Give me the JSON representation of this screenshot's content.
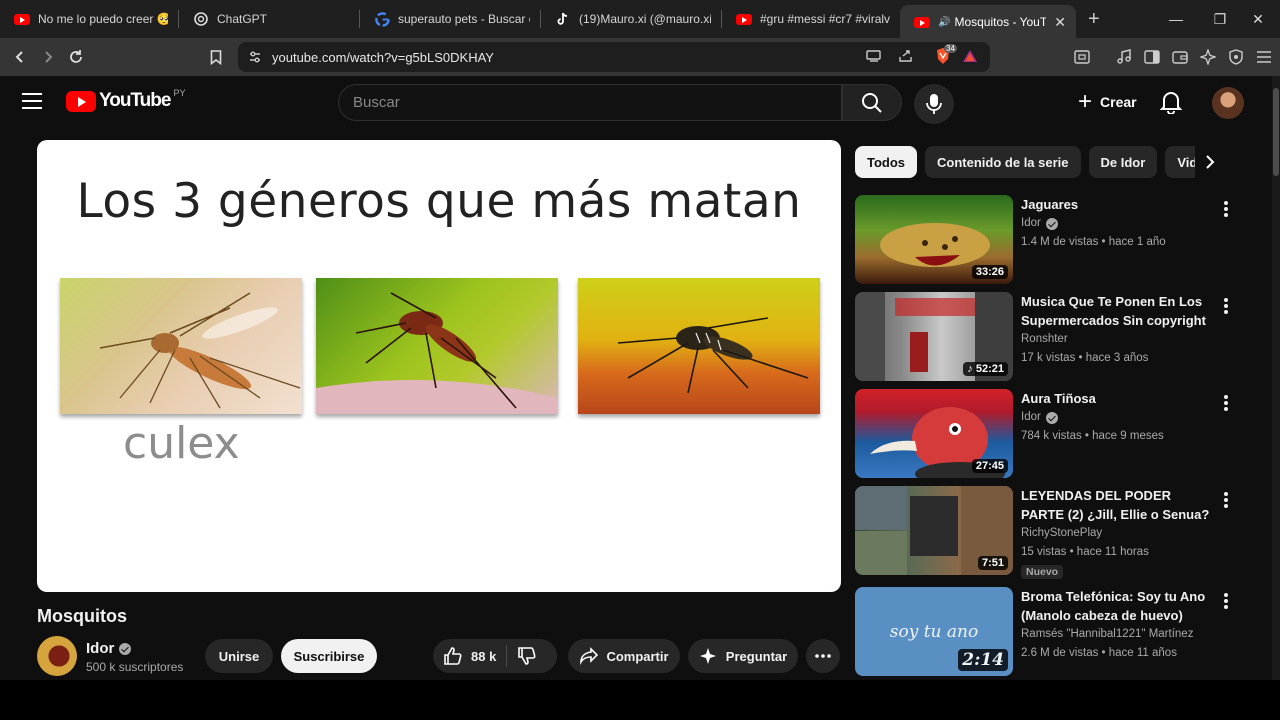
{
  "browser": {
    "tabs": [
      {
        "title": "No me lo puedo creer 🥺👍",
        "icon": "youtube-icon"
      },
      {
        "title": "ChatGPT",
        "icon": "chatgpt-icon"
      },
      {
        "title": "superauto pets - Buscar co",
        "icon": "google-icon"
      },
      {
        "title": "(19)Mauro.xi (@mauro.xi) |",
        "icon": "tiktok-icon"
      },
      {
        "title": "#gru #messi #cr7 #viralvid",
        "icon": "youtube-icon"
      },
      {
        "title": "Mosquitos - YouTu",
        "icon": "youtube-icon",
        "active": true
      }
    ],
    "url": "youtube.com/watch?v=g5bLS0DKHAY",
    "brave_badge": "34"
  },
  "youtube": {
    "logo_text": "YouTube",
    "country_code": "PY",
    "search_placeholder": "Buscar",
    "create_label": "Crear"
  },
  "video": {
    "slide_title": "Los 3 géneros que más matan",
    "slide_caption": "culex",
    "title": "Mosquitos",
    "channel": "Idor",
    "subscribers": "500 k suscriptores",
    "join_label": "Unirse",
    "subscribe_label": "Suscribirse",
    "likes": "88 k",
    "share_label": "Compartir",
    "ask_label": "Preguntar"
  },
  "chips": [
    "Todos",
    "Contenido de la serie",
    "De Idor",
    "Vide"
  ],
  "recommendations": [
    {
      "title": "Jaguares",
      "channel": "Idor",
      "verified": true,
      "stats": "1.4 M de vistas • hace 1 año",
      "duration": "33:26",
      "badge": ""
    },
    {
      "title": "Musica Que Te Ponen En Los Supermercados Sin copyright",
      "channel": "Ronshter",
      "verified": false,
      "stats": "17 k vistas • hace 3 años",
      "duration": "52:21",
      "badge": ""
    },
    {
      "title": "Aura Tiñosa",
      "channel": "Idor",
      "verified": true,
      "stats": "784 k vistas • hace 9 meses",
      "duration": "27:45",
      "badge": ""
    },
    {
      "title": "LEYENDAS DEL PODER PARTE (2) ¿Jill, Ellie o Senua? ...",
      "channel": "RichyStonePlay",
      "verified": false,
      "stats": "15 vistas • hace 11 horas",
      "duration": "7:51",
      "badge": "Nuevo"
    },
    {
      "title": "Broma Telefónica: Soy tu Ano (Manolo cabeza de huevo)",
      "channel": "Ramsés \"Hannibal1221\" Martínez",
      "verified": false,
      "stats": "2.6 M de vistas • hace 11 años",
      "duration": "2:14",
      "badge": "",
      "thumb_text": "soy tu ano"
    }
  ]
}
